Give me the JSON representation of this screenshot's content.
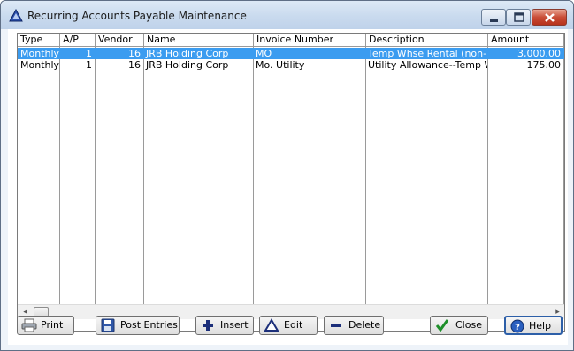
{
  "window": {
    "title": "Recurring Accounts Payable Maintenance",
    "icons": {
      "app": "delta-triangle-icon",
      "minimize": "minimize-icon",
      "maximize": "maximize-icon",
      "close": "close-icon"
    }
  },
  "grid": {
    "columns": [
      "Type",
      "A/P",
      "Vendor",
      "Name",
      "Invoice Number",
      "Description",
      "Amount"
    ],
    "rows": [
      {
        "type": "Monthly",
        "ap": "1",
        "vendor": "16",
        "name": "JRB Holding Corp",
        "invoice": "MO",
        "description": "Temp Whse Rental (non-lea",
        "amount": "3,000.00",
        "selected": true
      },
      {
        "type": "Monthly",
        "ap": "1",
        "vendor": "16",
        "name": "JRB Holding Corp",
        "invoice": "Mo. Utility",
        "description": "Utility Allowance--Temp Whs",
        "amount": "175.00",
        "selected": false
      }
    ],
    "scroll_left_arrow": "◂",
    "scroll_right_arrow": "▸"
  },
  "buttons": {
    "print": {
      "label": "Print",
      "underline": "P",
      "icon": "printer-icon"
    },
    "post_entries": {
      "label": "Post Entries",
      "underline": "E",
      "icon": "floppy-disk-icon"
    },
    "insert": {
      "label": "Insert",
      "underline": "I",
      "icon": "plus-icon"
    },
    "edit": {
      "label": "Edit",
      "underline": "E",
      "icon": "triangle-icon"
    },
    "delete": {
      "label": "Delete",
      "underline": "D",
      "icon": "minus-icon"
    },
    "close": {
      "label": "Close",
      "underline": "C",
      "icon": "checkmark-icon"
    },
    "help": {
      "label": "Help",
      "underline": "H",
      "icon": "help-icon"
    }
  },
  "colors": {
    "selection": "#3b9cf0",
    "title_bar": "#c9daee",
    "close_button": "#c94d37"
  }
}
